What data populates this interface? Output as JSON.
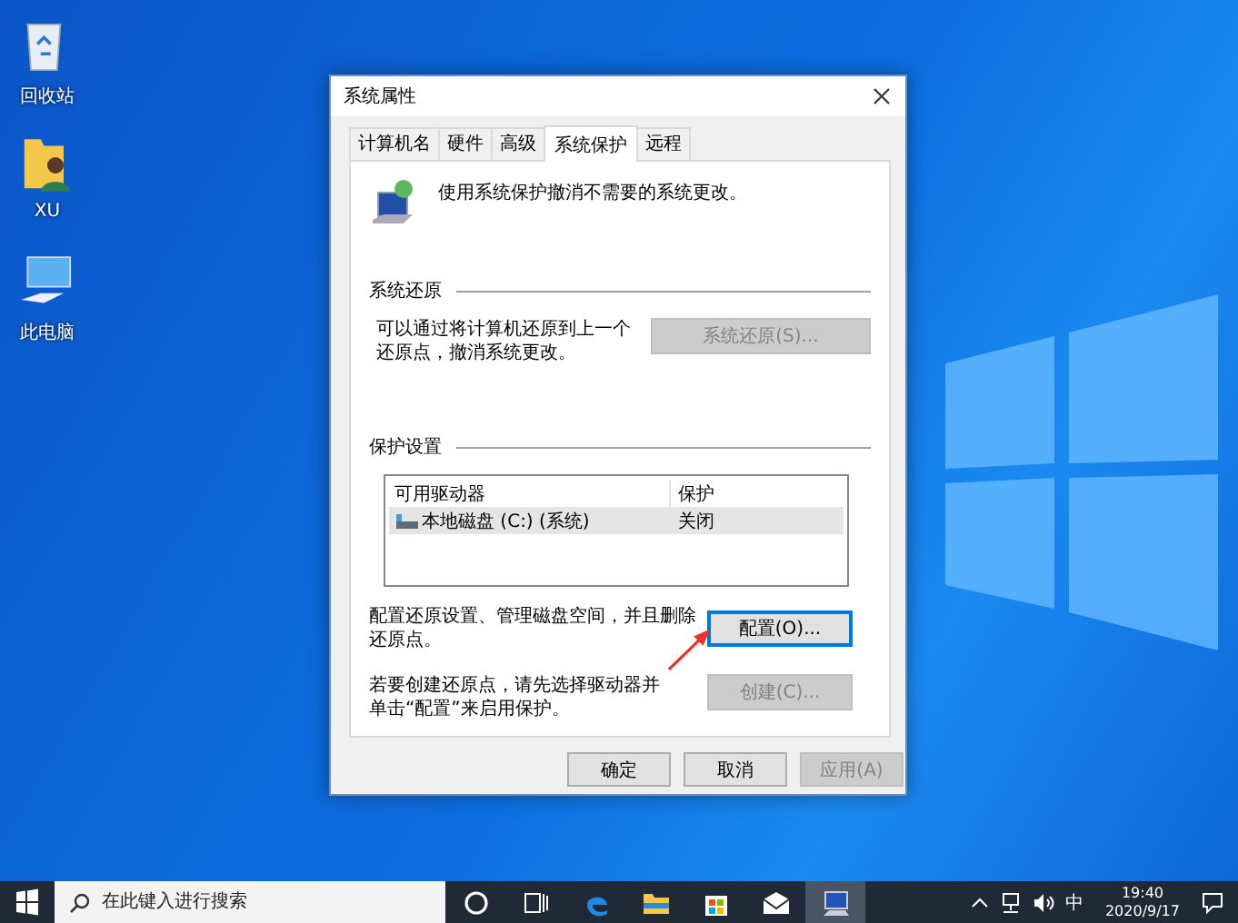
{
  "desktop_icons": [
    {
      "kind": "recycle",
      "label": "回收站"
    },
    {
      "kind": "user",
      "label": "XU"
    },
    {
      "kind": "pc",
      "label": "此电脑"
    }
  ],
  "dialog": {
    "title": "系统属性",
    "tabs": [
      {
        "label": "计算机名",
        "selected": false
      },
      {
        "label": "硬件",
        "selected": false
      },
      {
        "label": "高级",
        "selected": false
      },
      {
        "label": "系统保护",
        "selected": true
      },
      {
        "label": "远程",
        "selected": false
      }
    ],
    "intro": "使用系统保护撤消不需要的系统更改。",
    "restore": {
      "heading": "系统还原",
      "text": "可以通过将计算机还原到上一个还原点，撤消系统更改。",
      "button": {
        "label": "系统还原(S)...",
        "disabled": true,
        "focused": false
      }
    },
    "protection": {
      "heading": "保护设置",
      "columns": [
        "可用驱动器",
        "保护"
      ],
      "rows": [
        {
          "drive": "本地磁盘 (C:) (系统)",
          "protection": "关闭",
          "selected": true
        }
      ],
      "configure_text": "配置还原设置、管理磁盘空间，并且删除还原点。",
      "configure_button": {
        "label": "配置(O)...",
        "disabled": false,
        "focused": true
      },
      "create_text": "若要创建还原点，请先选择驱动器并单击“配置”来启用保护。",
      "create_button": {
        "label": "创建(C)...",
        "disabled": true,
        "focused": false
      }
    },
    "buttons": [
      {
        "label": "确定",
        "disabled": false,
        "focused": false
      },
      {
        "label": "取消",
        "disabled": false,
        "focused": false
      },
      {
        "label": "应用(A)",
        "disabled": true,
        "focused": false
      }
    ]
  },
  "taskbar": {
    "search": {
      "placeholder": "在此键入进行搜索"
    },
    "apps": [
      {
        "kind": "cortana",
        "active": false
      },
      {
        "kind": "taskview",
        "active": false
      },
      {
        "kind": "edge",
        "active": false
      },
      {
        "kind": "explorer",
        "active": false
      },
      {
        "kind": "store",
        "active": false
      },
      {
        "kind": "mail",
        "active": false
      },
      {
        "kind": "sysprops",
        "active": true
      }
    ],
    "tray": {
      "ime": "中",
      "time": "19:40",
      "date": "2020/9/17"
    }
  }
}
